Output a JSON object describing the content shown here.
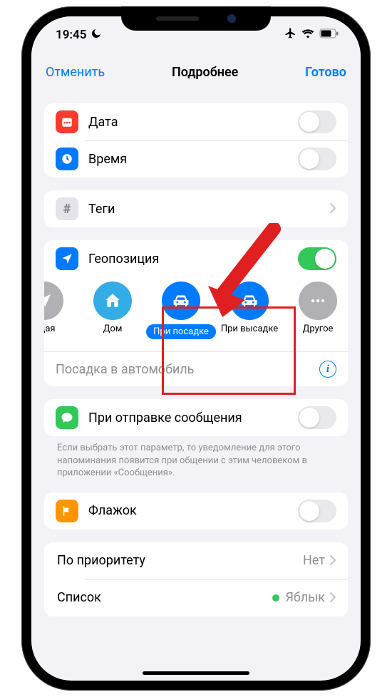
{
  "status": {
    "time": "19:45"
  },
  "nav": {
    "cancel": "Отменить",
    "title": "Подробнее",
    "done": "Готово"
  },
  "rows": {
    "date": "Дата",
    "time": "Время",
    "tags": "Теги",
    "location": "Геопозиция",
    "messaging": "При отправке сообщения",
    "flag": "Флажок",
    "priority_label": "По приоритету",
    "priority_value": "Нет",
    "list_label": "Список",
    "list_value": "Яблык"
  },
  "loc_options": {
    "current": "ущая",
    "home": "Дом",
    "getin": "При посадке",
    "getout": "При высадке",
    "other": "Другое"
  },
  "loc_detail": "Посадка в автомобиль",
  "footer": "Если выбрать этот параметр, то уведомление для этого напоминания появится при общении с этим человеком в приложении «Сообщения».",
  "colors": {
    "red": "#ff3b30",
    "blue": "#007aff",
    "cyan": "#32ade6",
    "gray": "#b0b0b5",
    "graylight": "#8e8e93",
    "green": "#34c759",
    "orange": "#ff9500",
    "hash": "#e4e4ea"
  }
}
